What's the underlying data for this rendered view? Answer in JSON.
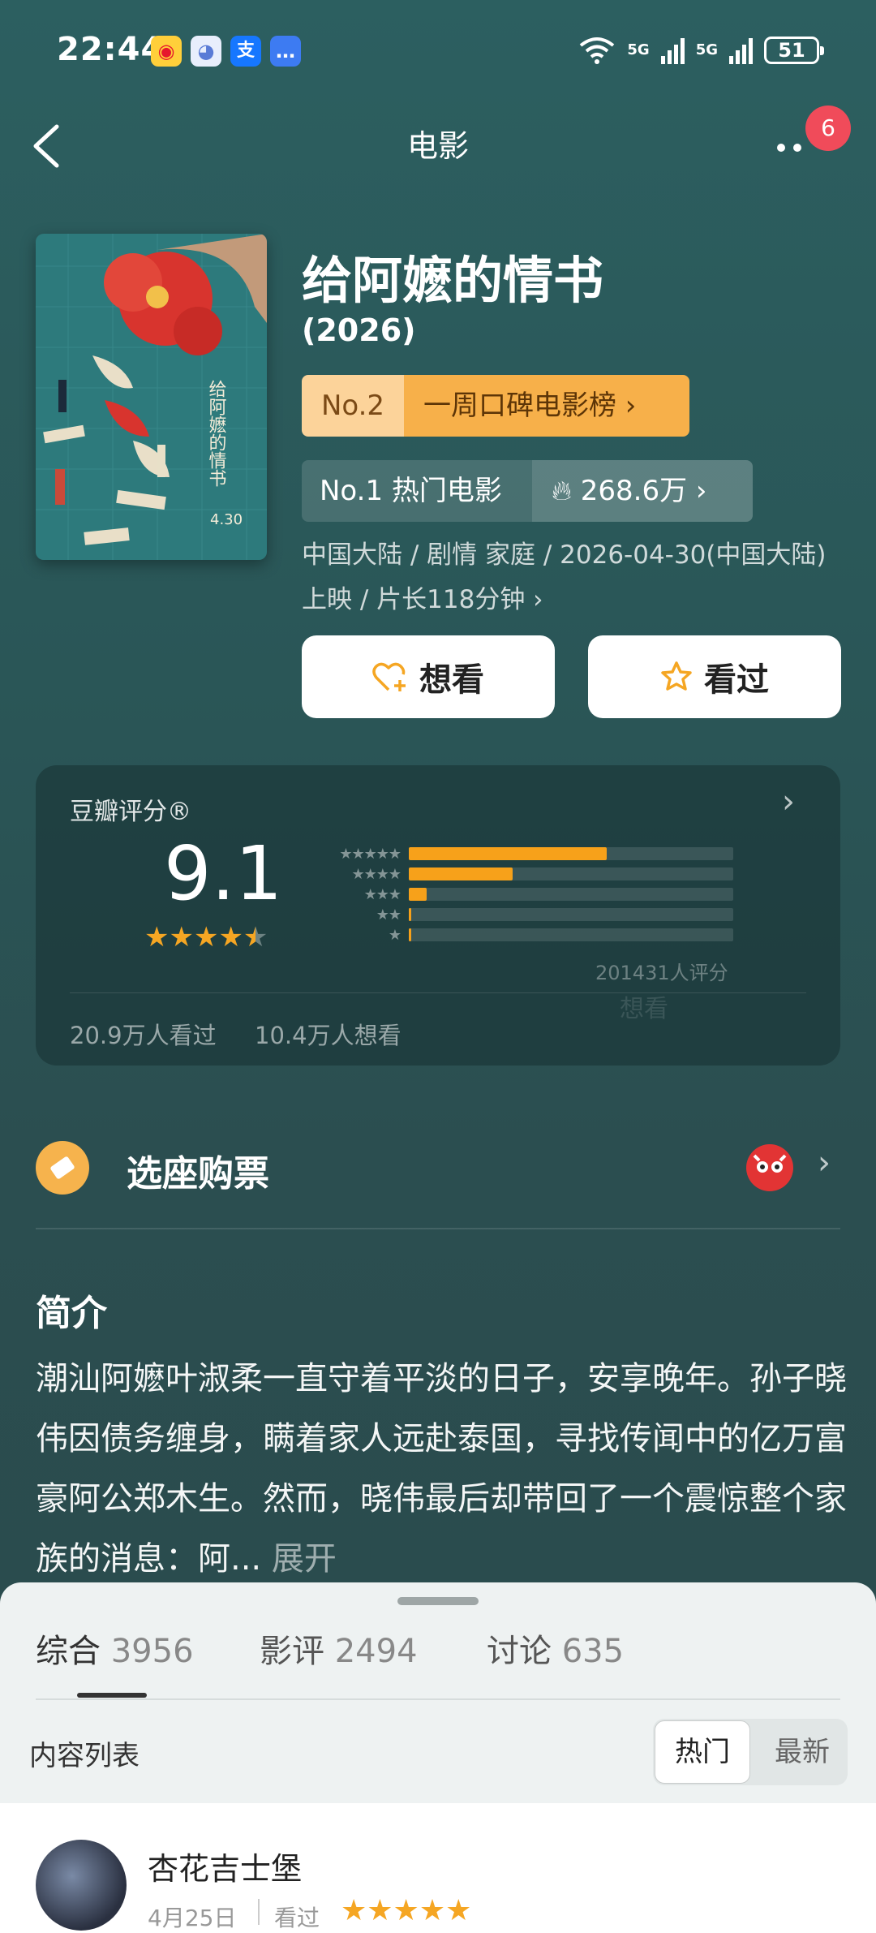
{
  "status": {
    "time": "22:44",
    "signal1": "5G",
    "signal2": "5G",
    "battery": "51"
  },
  "nav": {
    "title": "电影",
    "badge": "6"
  },
  "movie": {
    "title": "给阿嬷的情书",
    "year": "(2026)",
    "poster_date": "4.30",
    "rank1_no": "No.2",
    "rank1_label": "一周口碑电影榜 ›",
    "rank2_label": "No.1 热门电影",
    "rank2_heat": "268.6万 ›",
    "meta_line1": "中国大陆 / 剧情 家庭 / 2026-04-30(中国大陆)",
    "meta_line2": "上映 / 片长118分钟 ›",
    "want_label": "想看",
    "seen_label": "看过"
  },
  "rating": {
    "label": "豆瓣评分®",
    "score": "9.1",
    "stars_value": 4.5,
    "distribution": [
      0.61,
      0.32,
      0.055,
      0.008,
      0.004
    ],
    "count": "201431人评分",
    "ghost_text": "想看",
    "seen_count": "20.9万人看过",
    "want_count": "10.4万人想看"
  },
  "ticket": {
    "label": "选座购票"
  },
  "intro": {
    "heading": "简介",
    "text": "潮汕阿嬷叶淑柔一直守着平淡的日子，安享晚年。孙子晓伟因债务缠身，瞒着家人远赴泰国，寻找传闻中的亿万富豪阿公郑木生。然而，晓伟最后却带回了一个震惊整个家族的消息：阿...",
    "more": "展开"
  },
  "sheet": {
    "tabs": [
      {
        "label": "综合",
        "count": "3956"
      },
      {
        "label": "影评",
        "count": "2494"
      },
      {
        "label": "讨论",
        "count": "635"
      }
    ],
    "list_label": "内容列表",
    "seg_hot": "热门",
    "seg_new": "最新",
    "review": {
      "user": "杏花吉士堡",
      "date": "4月25日",
      "status": "看过",
      "stars": "★★★★★"
    }
  },
  "colors": {
    "accent": "#f7a11a",
    "badge": "#f04b5a",
    "bg": "#2c5f60"
  }
}
